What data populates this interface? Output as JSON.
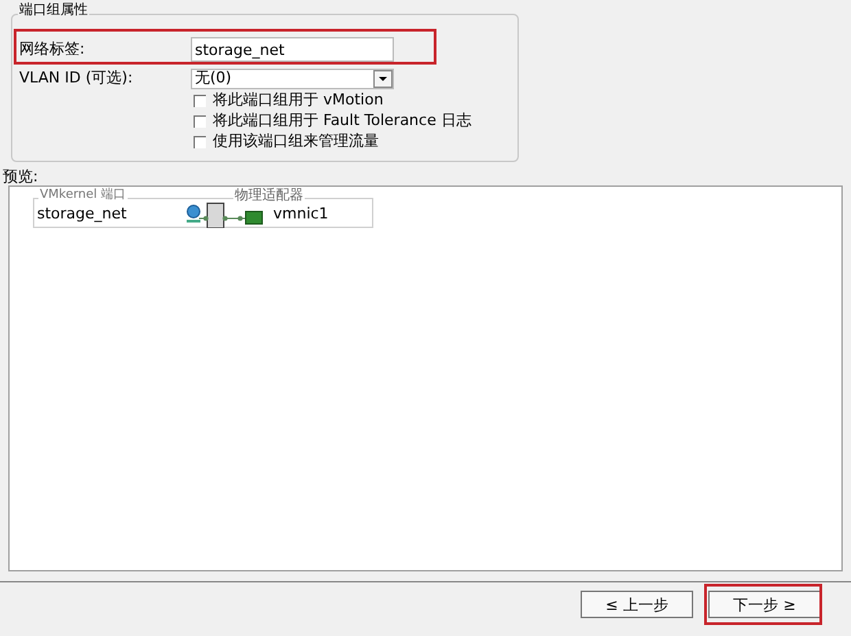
{
  "group": {
    "title": "端口组属性",
    "network_label": {
      "label": "网络标签:",
      "value": "storage_net"
    },
    "vlan": {
      "label": "VLAN ID (可选):",
      "value": "无(0)"
    },
    "options": [
      {
        "label": "将此端口组用于 vMotion",
        "checked": false
      },
      {
        "label": "将此端口组用于 Fault Tolerance 日志",
        "checked": false
      },
      {
        "label": "使用该端口组来管理流量",
        "checked": false
      }
    ]
  },
  "preview": {
    "title": "预览:",
    "port_title": "VMkernel 端口",
    "port_name": "storage_net",
    "adapter_title": "物理适配器",
    "adapter": "vmnic1"
  },
  "buttons": [
    {
      "label": "≤ 上一步"
    },
    {
      "label": "下一步 ≥"
    }
  ]
}
